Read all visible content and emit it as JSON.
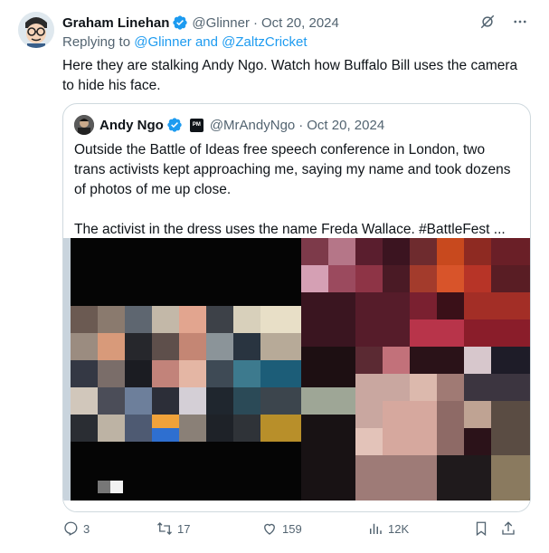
{
  "tweet": {
    "author_name": "Graham Linehan",
    "handle": "@Glinner",
    "separator": "·",
    "date": "Oct 20, 2024",
    "replying_prefix": "Replying to",
    "replying_to": "@Glinner and @ZaltzCricket",
    "text": "Here they are stalking Andy Ngo. Watch how Buffalo Bill uses the camera to hide his face."
  },
  "quote": {
    "author_name": "Andy Ngo",
    "org_badge": "PM",
    "handle": "@MrAndyNgo",
    "separator": "·",
    "date": "Oct 20, 2024",
    "paragraph_1": "Outside the Battle of Ideas free speech conference in London, two trans activists kept approaching me, saying my name and took dozens of photos of me up close.",
    "paragraph_2": "The activist in the dress uses the name Freda Wallace. #BattleFest ..."
  },
  "actions": {
    "replies": "3",
    "reposts": "17",
    "likes": "159",
    "views": "12K"
  },
  "colors": {
    "accent": "#1d9bf0",
    "muted": "#536471",
    "border": "#cfd9de"
  },
  "icons": [
    "verified-badge-icon",
    "grok-icon",
    "more-icon",
    "reply-icon",
    "repost-icon",
    "like-icon",
    "views-icon",
    "bookmark-icon",
    "share-icon"
  ]
}
